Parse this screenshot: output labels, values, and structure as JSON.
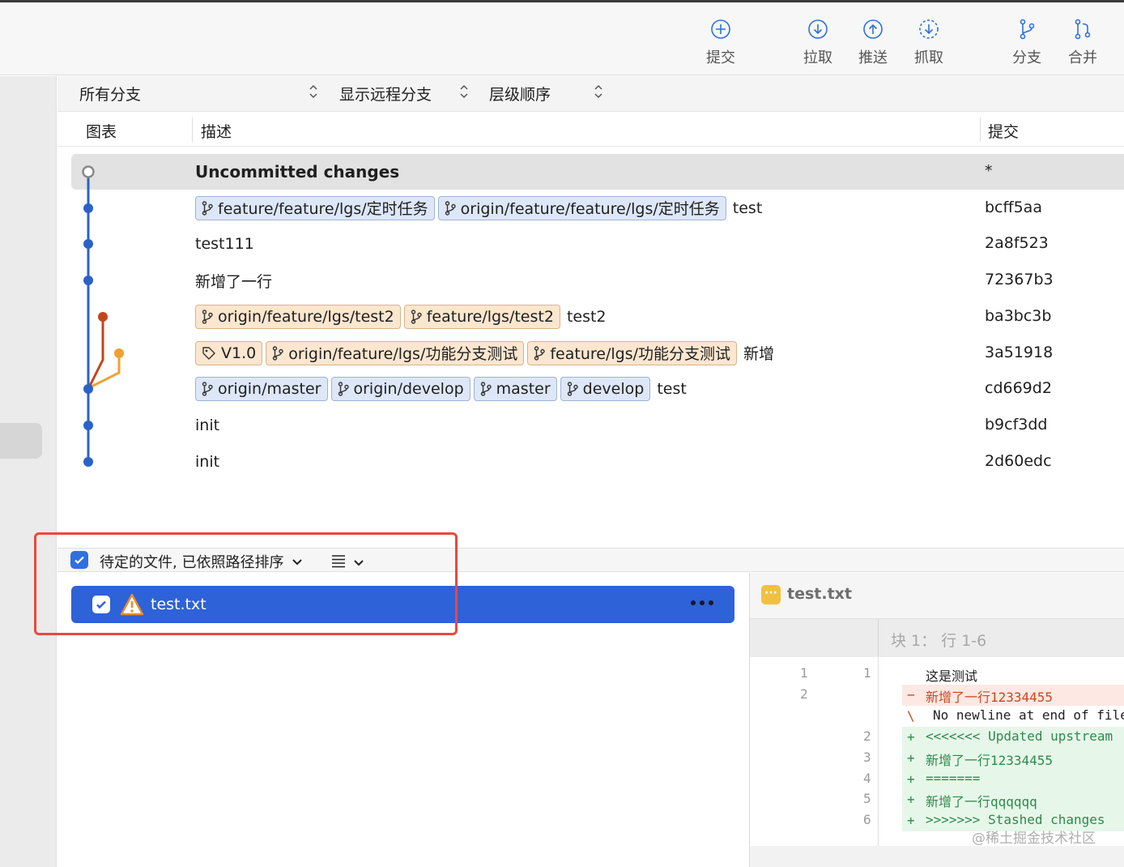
{
  "toolbar": {
    "commit": "提交",
    "pull": "拉取",
    "push": "推送",
    "fetch": "抓取",
    "branch": "分支",
    "merge": "合并"
  },
  "filters": {
    "branches": "所有分支",
    "remote": "显示远程分支",
    "order": "层级顺序"
  },
  "columns": {
    "graph": "图表",
    "description": "描述",
    "commit": "提交"
  },
  "commits": [
    {
      "desc": "Uncommitted changes",
      "hash": "*",
      "tags": []
    },
    {
      "desc": "test",
      "hash": "bcff5aa",
      "tags": [
        {
          "icon": "branch",
          "label": "feature/feature/lgs/定时任务"
        },
        {
          "icon": "branch",
          "label": "origin/feature/feature/lgs/定时任务"
        }
      ]
    },
    {
      "desc": "test111",
      "hash": "2a8f523",
      "tags": []
    },
    {
      "desc": "新增了一行",
      "hash": "72367b3",
      "tags": []
    },
    {
      "desc": "test2",
      "hash": "ba3bc3b",
      "tags": [
        {
          "icon": "branch",
          "label": "origin/feature/lgs/test2"
        },
        {
          "icon": "branch",
          "label": "feature/lgs/test2"
        }
      ]
    },
    {
      "desc": "新增",
      "hash": "3a51918",
      "tags": [
        {
          "icon": "tag",
          "label": "V1.0"
        },
        {
          "icon": "branch",
          "label": "origin/feature/lgs/功能分支测试"
        },
        {
          "icon": "branch",
          "label": "feature/lgs/功能分支测试"
        }
      ]
    },
    {
      "desc": "test",
      "hash": "cd669d2",
      "tags": [
        {
          "icon": "branch",
          "label": "origin/master"
        },
        {
          "icon": "branch",
          "label": "origin/develop"
        },
        {
          "icon": "branch",
          "label": "master"
        },
        {
          "icon": "branch",
          "label": "develop"
        }
      ]
    },
    {
      "desc": "init",
      "hash": "b9cf3dd",
      "tags": []
    },
    {
      "desc": "init",
      "hash": "2d60edc",
      "tags": []
    }
  ],
  "pending": {
    "label": "待定的文件, 已依照路径排序",
    "checked": true
  },
  "files": [
    {
      "name": "test.txt",
      "checked": true,
      "status": "warning-icon"
    }
  ],
  "diff": {
    "filename": "test.txt",
    "hunk": "块 1： 行 1-6",
    "lines": [
      {
        "old": "1",
        "new": "1",
        "marker": "",
        "text": "这是测试",
        "type": "ctx"
      },
      {
        "old": "2",
        "new": "",
        "marker": "−",
        "text": "新增了一行12334455",
        "type": "del"
      },
      {
        "old": "",
        "new": "",
        "marker": "\\",
        "text": "No newline at end of file",
        "type": "warn"
      },
      {
        "old": "",
        "new": "2",
        "marker": "+",
        "text": "<<<<<<< Updated upstream",
        "type": "add"
      },
      {
        "old": "",
        "new": "3",
        "marker": "+",
        "text": "新增了一行12334455",
        "type": "add"
      },
      {
        "old": "",
        "new": "4",
        "marker": "+",
        "text": "=======",
        "type": "add"
      },
      {
        "old": "",
        "new": "5",
        "marker": "+",
        "text": "新增了一行qqqqqq",
        "type": "add"
      },
      {
        "old": "",
        "new": "6",
        "marker": "+",
        "text": ">>>>>>> Stashed changes",
        "type": "add"
      }
    ]
  },
  "watermark": "@稀土掘金技术社区",
  "colors": {
    "accent": "#2d62d8",
    "graph_main": "#2a62c9",
    "graph_branch_red": "#c2461a",
    "graph_branch_orange": "#f0a030",
    "highlight_box": "#e84a3a"
  }
}
